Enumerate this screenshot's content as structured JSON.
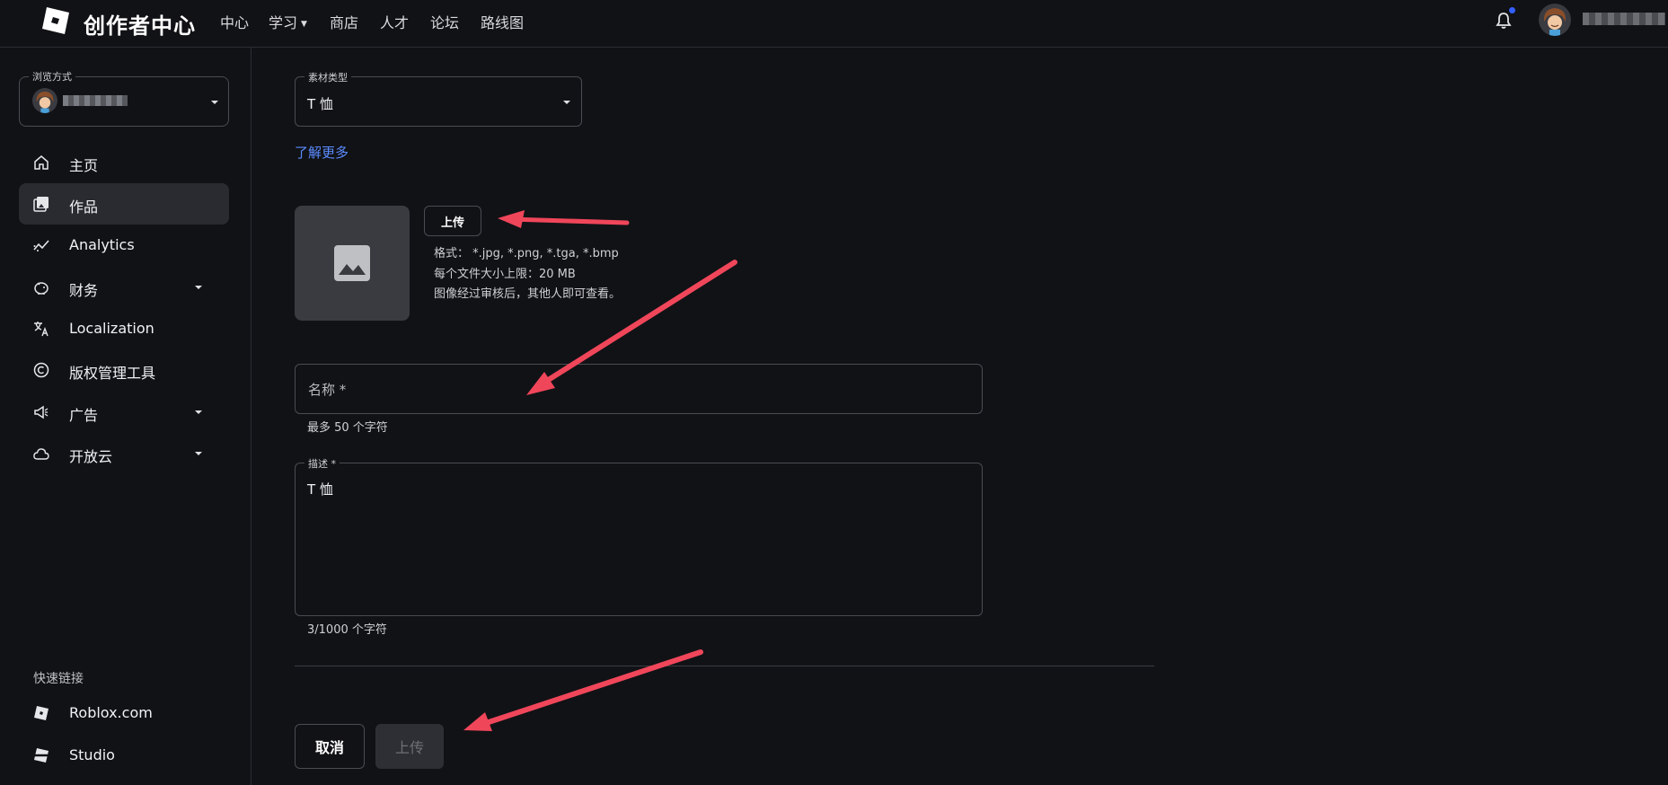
{
  "header": {
    "brand": "创作者中心",
    "nav": [
      {
        "label": "中心",
        "has_caret": false
      },
      {
        "label": "学习",
        "has_caret": true
      },
      {
        "label": "商店",
        "has_caret": false
      },
      {
        "label": "人才",
        "has_caret": false
      },
      {
        "label": "论坛",
        "has_caret": false
      },
      {
        "label": "路线图",
        "has_caret": false
      }
    ],
    "username": "███████",
    "notification_dot_color": "#335fff"
  },
  "sidebar": {
    "view_mode_label": "浏览方式",
    "view_mode_value": "██████",
    "items": [
      {
        "label": "主页",
        "icon": "home-icon",
        "active": false,
        "has_caret": false
      },
      {
        "label": "作品",
        "icon": "creations-icon",
        "active": true,
        "has_caret": false
      },
      {
        "label": "Analytics",
        "icon": "analytics-icon",
        "active": false,
        "has_caret": false
      },
      {
        "label": "财务",
        "icon": "finance-icon",
        "active": false,
        "has_caret": true
      },
      {
        "label": "Localization",
        "icon": "translate-icon",
        "active": false,
        "has_caret": false
      },
      {
        "label": "版权管理工具",
        "icon": "copyright-icon",
        "active": false,
        "has_caret": false
      },
      {
        "label": "广告",
        "icon": "megaphone-icon",
        "active": false,
        "has_caret": true
      },
      {
        "label": "开放云",
        "icon": "cloud-icon",
        "active": false,
        "has_caret": true
      }
    ],
    "quick_links_title": "快速链接",
    "quick_links": [
      {
        "label": "Roblox.com",
        "icon": "roblox-icon"
      },
      {
        "label": "Studio",
        "icon": "studio-icon"
      }
    ]
  },
  "form": {
    "asset_type_label": "素材类型",
    "asset_type_value": "T 恤",
    "learn_more": "了解更多",
    "upload_button": "上传",
    "format_line": "格式：  *.jpg, *.png, *.tga, *.bmp",
    "size_line": "每个文件大小上限：20 MB",
    "review_line": "图像经过审核后，其他人即可查看。",
    "name_placeholder": "名称 *",
    "name_helper": "最多 50 个字符",
    "description_label": "描述 *",
    "description_value": "T 恤",
    "description_helper": "3/1000 个字符",
    "cancel_button": "取消",
    "submit_button": "上传"
  },
  "colors": {
    "background": "#111216",
    "accent_link": "#5b8cff",
    "arrow_annotation": "#f0465a"
  }
}
